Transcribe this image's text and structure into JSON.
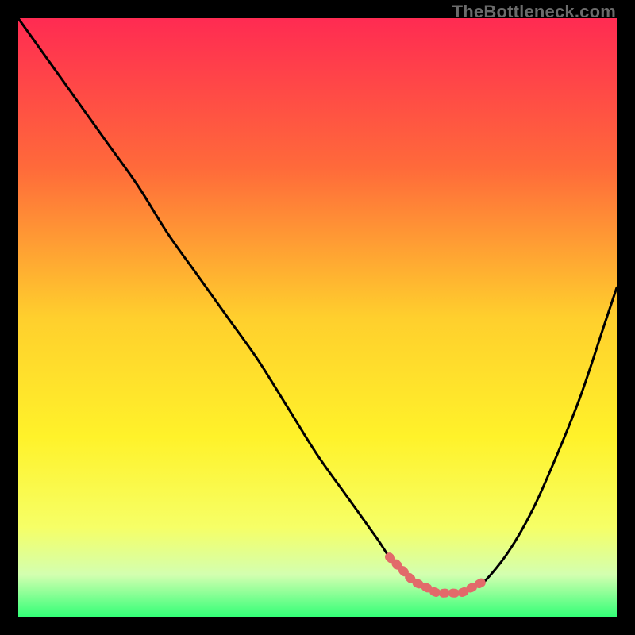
{
  "watermark": "TheBottleneck.com",
  "colors": {
    "frame_bg": "#000000",
    "gradient_stops": [
      {
        "offset": 0.0,
        "color": "#ff2b52"
      },
      {
        "offset": 0.25,
        "color": "#ff6a3a"
      },
      {
        "offset": 0.5,
        "color": "#ffcf2d"
      },
      {
        "offset": 0.7,
        "color": "#fff22a"
      },
      {
        "offset": 0.85,
        "color": "#f6ff66"
      },
      {
        "offset": 0.93,
        "color": "#d3ffb0"
      },
      {
        "offset": 1.0,
        "color": "#33ff77"
      }
    ],
    "curve_stroke": "#000000",
    "highlight_stroke": "#e26a6a"
  },
  "chart_data": {
    "type": "line",
    "title": "",
    "xlabel": "",
    "ylabel": "",
    "xlim": [
      0,
      100
    ],
    "ylim": [
      0,
      100
    ],
    "grid": false,
    "legend": false,
    "series": [
      {
        "name": "curve",
        "x": [
          0,
          5,
          10,
          15,
          20,
          25,
          30,
          35,
          40,
          45,
          50,
          55,
          60,
          62,
          64,
          66,
          68,
          70,
          72,
          74,
          76,
          78,
          82,
          86,
          90,
          94,
          98,
          100
        ],
        "values": [
          100,
          93,
          86,
          79,
          72,
          64,
          57,
          50,
          43,
          35,
          27,
          20,
          13,
          10,
          8,
          6,
          5,
          4,
          4,
          4,
          5,
          6,
          11,
          18,
          27,
          37,
          49,
          55
        ]
      }
    ],
    "highlight_range": {
      "x_start": 62,
      "x_end": 78
    }
  }
}
